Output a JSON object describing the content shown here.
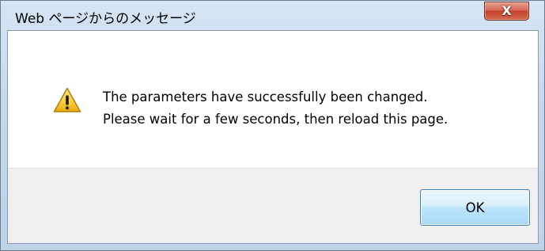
{
  "dialog": {
    "title": "Web ページからのメッセージ",
    "close_label": "X",
    "message_lines": [
      "The parameters have successfully been changed.",
      "Please wait for a few seconds, then reload this page."
    ],
    "icon": "warning-icon",
    "ok_label": "OK"
  },
  "colors": {
    "close_button": "#c5432d",
    "ok_button_border": "#3c7fb1",
    "frame": "#bfd3e8"
  }
}
